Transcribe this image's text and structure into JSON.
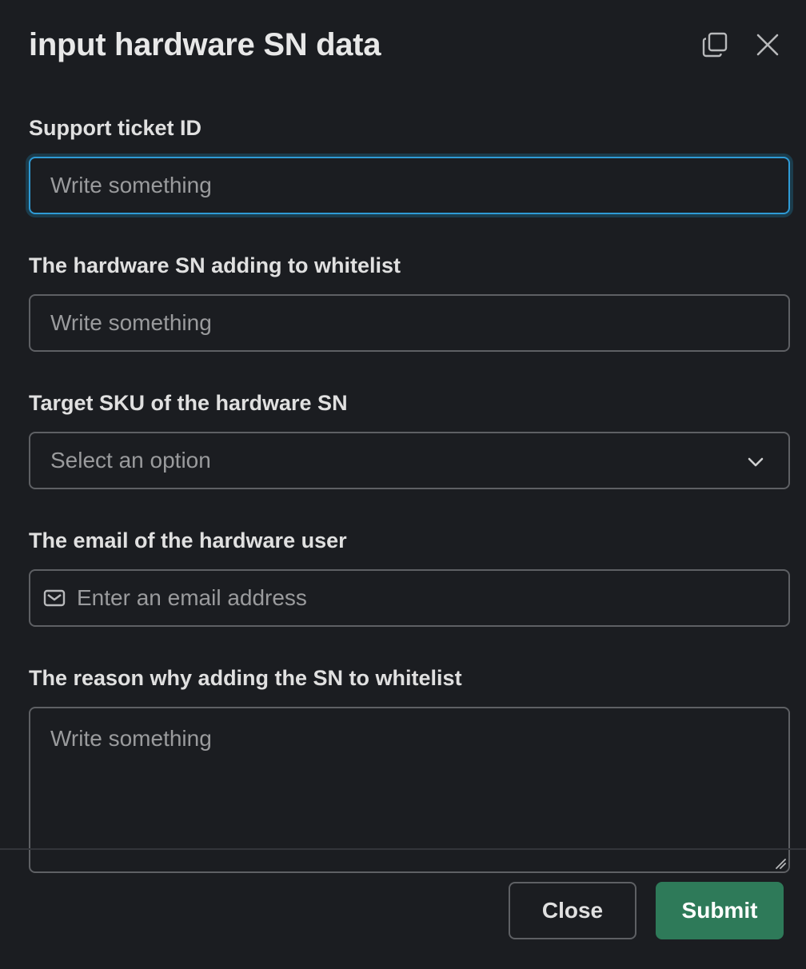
{
  "modal": {
    "title": "input hardware SN data",
    "icons": {
      "popout": "copy-window-icon",
      "close": "close-icon"
    }
  },
  "fields": {
    "ticket": {
      "label": "Support ticket ID",
      "placeholder": "Write something"
    },
    "sn": {
      "label": "The hardware SN adding to whitelist",
      "placeholder": "Write something"
    },
    "sku": {
      "label": "Target SKU of the hardware SN",
      "placeholder": "Select an option"
    },
    "email": {
      "label": "The email of the hardware user",
      "placeholder": "Enter an email address"
    },
    "reason": {
      "label": "The reason why adding the SN to whitelist",
      "placeholder": "Write something"
    }
  },
  "footer": {
    "close_label": "Close",
    "submit_label": "Submit"
  },
  "colors": {
    "background": "#1b1d21",
    "focus_border": "#2f9bd6",
    "submit_bg": "#2e7a59"
  }
}
